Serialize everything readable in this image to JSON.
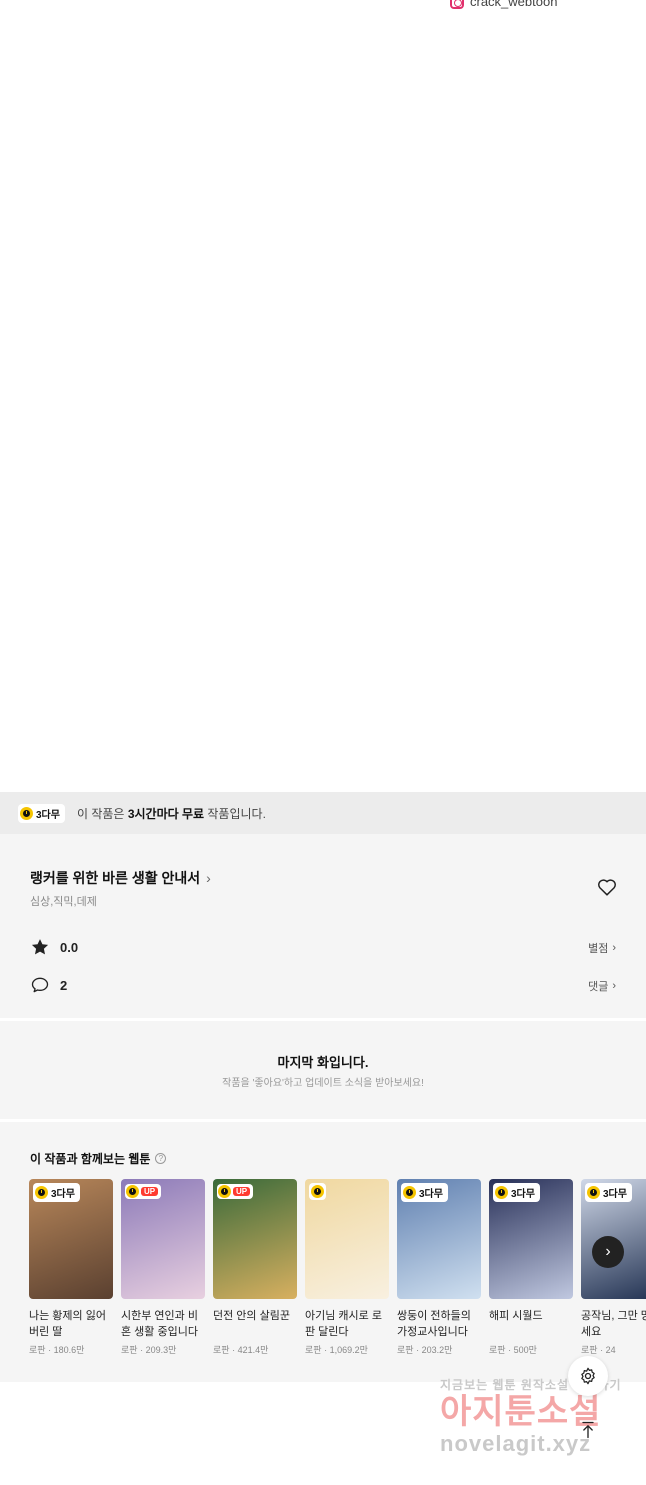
{
  "credit": {
    "handle": "crack_webtoon",
    "icon": "instagram-icon"
  },
  "free_banner": {
    "badge": "3다무",
    "text_before": "이 작품은 ",
    "text_bold": "3시간마다 무료",
    "text_after": " 작품입니다."
  },
  "work": {
    "title": "랭커를 위한 바른 생활 안내서",
    "genres": "심상,직믹,데제",
    "rating": "0.0",
    "rating_link": "별점",
    "comments": "2",
    "comments_link": "댓글"
  },
  "last_episode": {
    "title": "마지막 화입니다.",
    "subtitle": "작품을 '좋아요'하고 업데이트 소식을 받아보세요!"
  },
  "recommendations": {
    "heading": "이 작품과 함께보는 웹툰",
    "items": [
      {
        "badge": "3다무",
        "badge_type": "free",
        "title": "나는 황제의 잃어버린 딸",
        "genre": "로판",
        "views": "180.6만",
        "colors": [
          "#b8875a",
          "#5a4030"
        ]
      },
      {
        "badge": "UP",
        "badge_type": "up",
        "title": "시한부 연인과 비혼 생활 중입니다",
        "genre": "로판",
        "views": "209.3만",
        "colors": [
          "#8c7ab8",
          "#e8d0e0"
        ]
      },
      {
        "badge": "UP",
        "badge_type": "up",
        "title": "던전 안의 살림꾼",
        "genre": "로판",
        "views": "421.4만",
        "colors": [
          "#3a6a3a",
          "#d8b060"
        ]
      },
      {
        "badge": "",
        "badge_type": "free-icon",
        "title": "아기님 캐시로 로판 달린다",
        "genre": "로판",
        "views": "1,069.2만",
        "colors": [
          "#f0d8a0",
          "#f8f0e0"
        ]
      },
      {
        "badge": "3다무",
        "badge_type": "free",
        "title": "쌍둥이 전하들의 가정교사입니다",
        "genre": "로판",
        "views": "203.2만",
        "colors": [
          "#6080b0",
          "#d0e0f0"
        ]
      },
      {
        "badge": "3다무",
        "badge_type": "free",
        "title": "해피 시월드",
        "genre": "로판",
        "views": "500만",
        "colors": [
          "#283058",
          "#c0c8e0"
        ]
      },
      {
        "badge": "3다무",
        "badge_type": "free",
        "title": "공작님, 그만 망하세요",
        "genre": "로판",
        "views": "24",
        "colors": [
          "#d0d8e8",
          "#203050"
        ]
      }
    ]
  },
  "controls": {
    "next_symbol": "›",
    "settings_icon": "gear-icon",
    "top_icon": "arrow-up-icon"
  },
  "watermark": {
    "line1": "지금보는 웹툰 원작소설 보러가기",
    "line2": "아지툰소설",
    "line3": "novelagit.xyz"
  }
}
